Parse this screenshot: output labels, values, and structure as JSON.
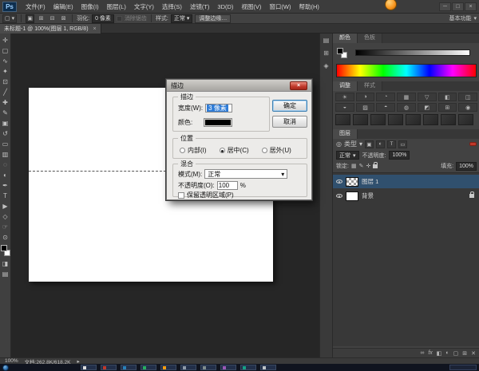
{
  "menubar": {
    "logo": "Ps",
    "items": [
      "文件(F)",
      "编辑(E)",
      "图像(I)",
      "图层(L)",
      "文字(Y)",
      "选择(S)",
      "滤镜(T)",
      "3D(D)",
      "视图(V)",
      "窗口(W)",
      "帮助(H)"
    ],
    "window_controls": {
      "minimize": "─",
      "maximize": "□",
      "close": "×"
    }
  },
  "options": {
    "tool_preset_icon": "▢",
    "dropdown_arrow": "▾",
    "combine_icons": [
      "▣",
      "⊞",
      "⊟",
      "⊠"
    ],
    "feather_label": "羽化:",
    "feather_value": "0 像素",
    "antialias_label": "消除锯齿",
    "style_label": "样式:",
    "style_value": "正常",
    "refine_edge_label": "调整边缘…",
    "workspace_label": "基本功能"
  },
  "doc_tab": {
    "title": "未标题-1 @ 100%(图层 1, RGB/8)",
    "close_icon": "×"
  },
  "toolbar": {
    "tools": [
      {
        "name": "move",
        "glyph": "✛"
      },
      {
        "name": "rect-marquee",
        "glyph": "▢"
      },
      {
        "name": "lasso",
        "glyph": "∿"
      },
      {
        "name": "quick-selection",
        "glyph": "✦"
      },
      {
        "name": "crop",
        "glyph": "⊡"
      },
      {
        "name": "eyedropper",
        "glyph": "╱"
      },
      {
        "name": "healing-brush",
        "glyph": "✚"
      },
      {
        "name": "brush",
        "glyph": "✎"
      },
      {
        "name": "clone-stamp",
        "glyph": "▣"
      },
      {
        "name": "history-brush",
        "glyph": "↺"
      },
      {
        "name": "eraser",
        "glyph": "▭"
      },
      {
        "name": "gradient",
        "glyph": "▥"
      },
      {
        "name": "blur",
        "glyph": "◌"
      },
      {
        "name": "dodge",
        "glyph": "◐"
      },
      {
        "name": "pen",
        "glyph": "✒"
      },
      {
        "name": "type",
        "glyph": "T"
      },
      {
        "name": "path-selection",
        "glyph": "▶"
      },
      {
        "name": "shape",
        "glyph": "◇"
      },
      {
        "name": "hand",
        "glyph": "☞"
      },
      {
        "name": "zoom",
        "glyph": "⊙"
      }
    ],
    "extra_icons": [
      "◨",
      "▤"
    ]
  },
  "dialog": {
    "title": "描边",
    "close_icon": "×",
    "stroke": {
      "legend": "描边",
      "width_label": "宽度(W):",
      "width_value": "3 像素",
      "color_label": "颜色:",
      "color_value": "#000000"
    },
    "ok_label": "确定",
    "cancel_label": "取消",
    "position": {
      "legend": "位置",
      "options": [
        {
          "label": "内部(I)",
          "selected": false
        },
        {
          "label": "居中(C)",
          "selected": true
        },
        {
          "label": "居外(U)",
          "selected": false
        }
      ]
    },
    "blend": {
      "legend": "混合",
      "mode_label": "模式(M):",
      "mode_value": "正常",
      "opacity_label": "不透明度(O):",
      "opacity_value": "100",
      "percent_label": "%",
      "preserve_label": "保留透明区域(P)"
    }
  },
  "panels": {
    "dock_icons": [
      "▤",
      "⊞",
      "◈"
    ],
    "color": {
      "tabs": [
        "颜色",
        "色板"
      ],
      "slider_handle": "▾"
    },
    "adjustments": {
      "tabs": [
        "调整",
        "样式"
      ],
      "icons": [
        "☀",
        "◑",
        "◔",
        "▦",
        "▽",
        "◧",
        "◫",
        "◒",
        "▨",
        "◓",
        "◍",
        "◩",
        "⊞",
        "◉"
      ]
    },
    "layers": {
      "tab": "图层",
      "filter": {
        "kind_icon": "◎",
        "kind_label": "类型",
        "arrow": "▾",
        "icons": [
          "▣",
          "◐",
          "T",
          "▭"
        ]
      },
      "blend_mode": "正常",
      "blend_arrow": "▾",
      "opacity_label": "不透明度:",
      "opacity_value": "100%",
      "lock_label": "锁定:",
      "lock_icons": [
        "▦",
        "✎",
        "✛"
      ],
      "fill_label": "填充:",
      "fill_value": "100%",
      "rows": [
        {
          "name": "图层 1",
          "selected": true,
          "locked": false
        },
        {
          "name": "背景",
          "selected": false,
          "locked": true
        }
      ],
      "footer_icons": [
        "∞",
        "fx",
        "◧",
        "◐",
        "▢",
        "⊞",
        "✕"
      ]
    }
  },
  "statusbar": {
    "zoom": "100%",
    "doc_label": "文档:262.8K/618.2K",
    "flyout_arrow": "▸"
  },
  "colors": {
    "layer_selection": "#30506e",
    "input_selection": "#2f7cd6",
    "canvas_bg": "#262626",
    "dialog_bg": "#ecebe9",
    "stroke_color": "#000000"
  }
}
